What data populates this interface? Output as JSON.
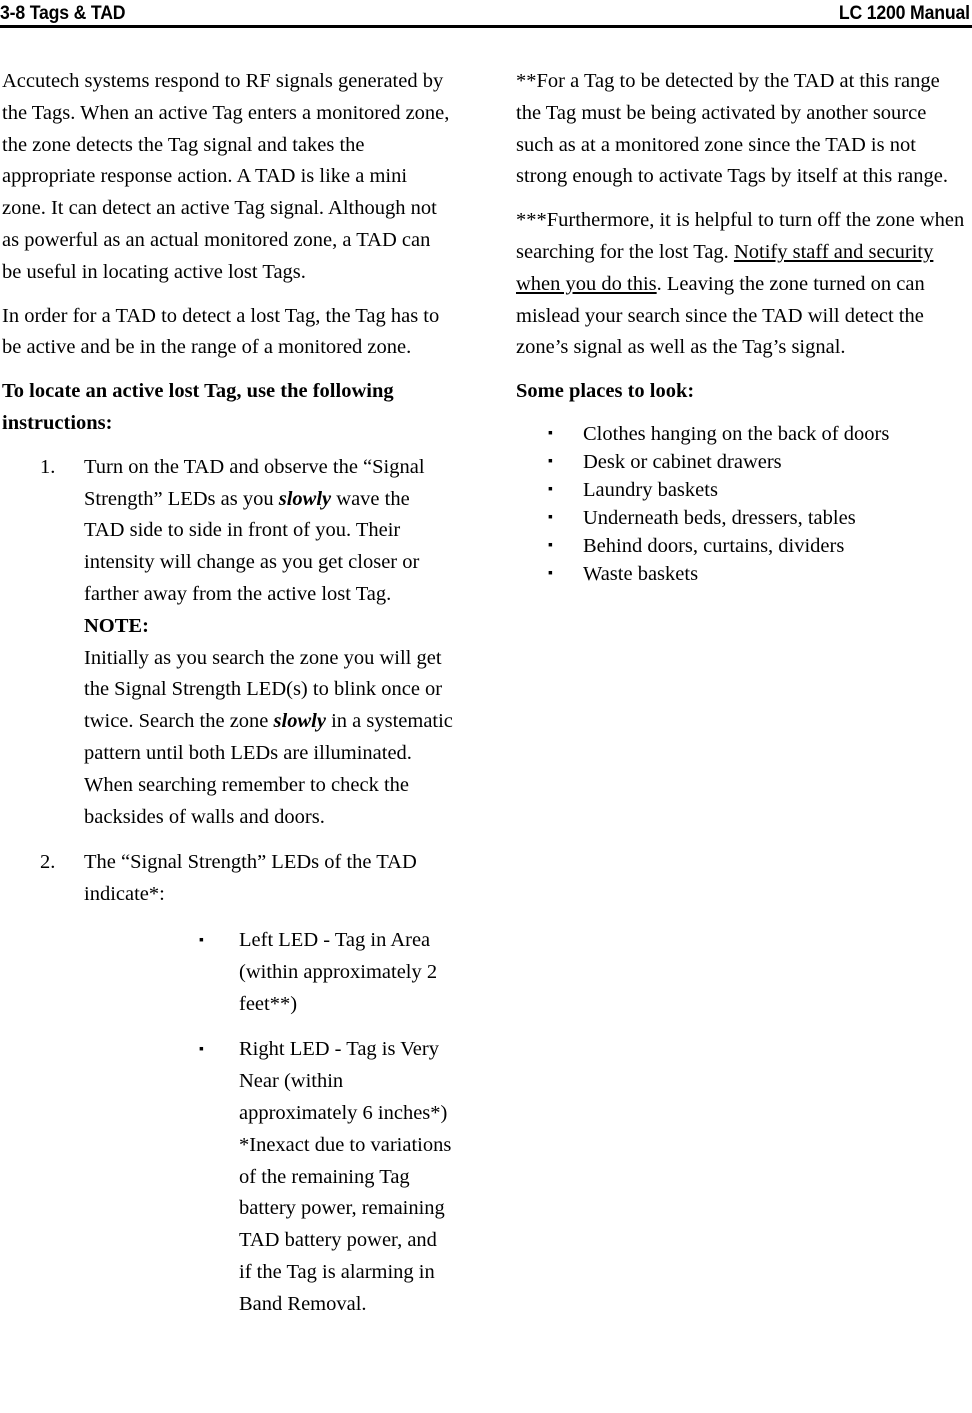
{
  "header": {
    "left": "3-8 Tags & TAD",
    "right": "LC 1200 Manual"
  },
  "left_column": {
    "paragraph_1": "Accutech systems respond to RF signals generated by the Tags. When an active Tag enters a monitored zone, the zone detects the Tag signal and takes the appropriate response action. A TAD is like a mini zone. It can detect an active Tag signal. Although not as powerful as an actual monitored zone, a TAD can be useful in locating active lost Tags.",
    "paragraph_2": "In order for a TAD to detect a lost Tag, the Tag has to be active and be in the range of a monitored zone.",
    "instructions_heading": "To locate an active lost Tag, use the following instructions:",
    "steps": [
      {
        "number": "1.",
        "text_part_1": "Turn on the TAD and observe the “Signal Strength” LEDs as you ",
        "emphasis_1": "slowly",
        "text_part_2": " wave the TAD side to side in front of you. Their intensity will change as you get closer or farther away from the active lost Tag.",
        "note_label": "NOTE:",
        "note_part_1": "Initially as you search the zone you will get the Signal Strength LED(s) to blink once or twice. Search the zone ",
        "note_emphasis": "slowly",
        "note_part_2": " in a systematic pattern until both LEDs are illuminated. When searching remember to check the backsides of walls and doors."
      },
      {
        "number": "2.",
        "text_part_1": "The “Signal Strength” LEDs of the TAD indicate*:",
        "sub_bullets": [
          {
            "bullet_glyph": "▪",
            "text": "Left LED - Tag in Area (within approximately 2 feet**)"
          },
          {
            "bullet_glyph": "▪",
            "text": "Right LED - Tag is Very Near (within approximately 6 inches*)",
            "footnote": "*Inexact due to variations of the remaining Tag battery power, remaining TAD battery power, and if the Tag is alarming in Band Removal."
          }
        ]
      }
    ]
  },
  "right_column": {
    "footnote_2": "**For a Tag to be detected by the TAD at this range the Tag must be being activated by another source such as at a monitored zone since the TAD is not strong enough to activate Tags by itself at this range.",
    "footnote_3_part_1": "***Furthermore, it is helpful to turn off the zone when searching for the lost Tag. ",
    "footnote_3_underlined": "Notify staff and security when you do this",
    "footnote_3_part_2": ". Leaving the zone turned on can mislead your search since the TAD will detect the zone’s signal as well as the Tag’s signal.",
    "places_heading": "Some places to look:",
    "places": [
      {
        "bullet_glyph": "▪",
        "text": "Clothes hanging on the back of doors"
      },
      {
        "bullet_glyph": "▪",
        "text": "Desk or cabinet drawers"
      },
      {
        "bullet_glyph": "▪",
        "text": "Laundry baskets"
      },
      {
        "bullet_glyph": "▪",
        "text": "Underneath beds, dressers, tables"
      },
      {
        "bullet_glyph": "▪",
        "text": "Behind doors, curtains, dividers"
      },
      {
        "bullet_glyph": "▪",
        "text": "Waste baskets"
      }
    ]
  },
  "colors": {
    "text": "#000000",
    "page_background": "#ffffff",
    "rule": "#000000"
  }
}
